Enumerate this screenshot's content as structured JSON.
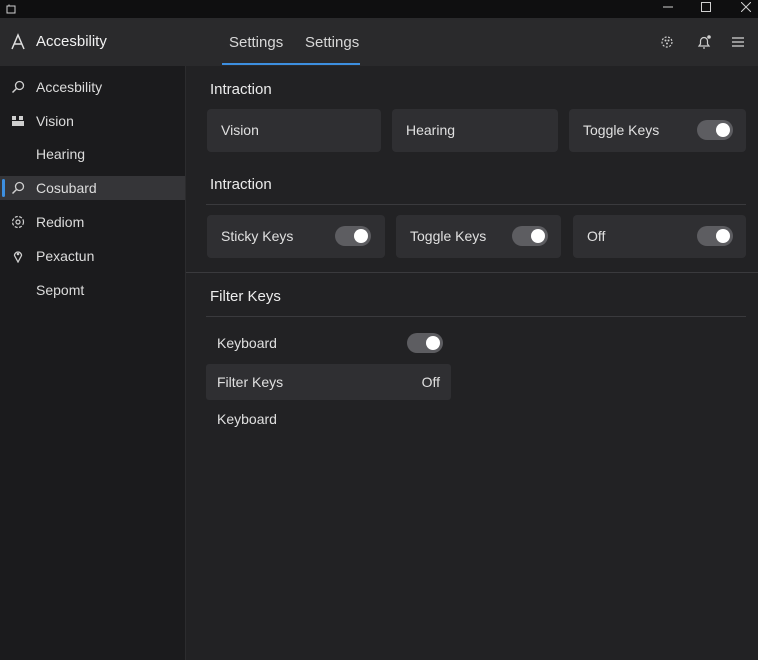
{
  "header": {
    "app_title": "Accesbility",
    "tabs": [
      {
        "label": "Settings"
      },
      {
        "label": "Settings"
      }
    ]
  },
  "sidebar": {
    "items": [
      {
        "label": "Accesbility",
        "icon": "search-icon"
      },
      {
        "label": "Vision",
        "icon": "grid-icon"
      },
      {
        "label": "Hearing",
        "icon": ""
      },
      {
        "label": "Cosubard",
        "icon": "search-icon",
        "active": true
      },
      {
        "label": "Rediom",
        "icon": "target-icon"
      },
      {
        "label": "Pexactun",
        "icon": "location-pin-icon"
      },
      {
        "label": "Sepomt",
        "icon": ""
      }
    ]
  },
  "main": {
    "section1": {
      "title": "Intraction",
      "cards": [
        {
          "label": "Vision"
        },
        {
          "label": "Hearing"
        },
        {
          "label": "Toggle Keys",
          "toggle": true
        }
      ]
    },
    "section2": {
      "title": "Intraction",
      "cards": [
        {
          "label": "Sticky Keys",
          "toggle": true
        },
        {
          "label": "Toggle Keys",
          "toggle": true
        },
        {
          "label": "Off",
          "toggle": true
        }
      ]
    },
    "section3": {
      "title": "Filter Keys",
      "rows": [
        {
          "label": "Keyboard",
          "toggle": true
        },
        {
          "label": "Filter Keys",
          "value": "Off"
        },
        {
          "label": "Keyboard"
        }
      ]
    }
  },
  "colors": {
    "accent": "#3d8fe0",
    "background": "#1e1e20",
    "card": "#2f2f32"
  }
}
